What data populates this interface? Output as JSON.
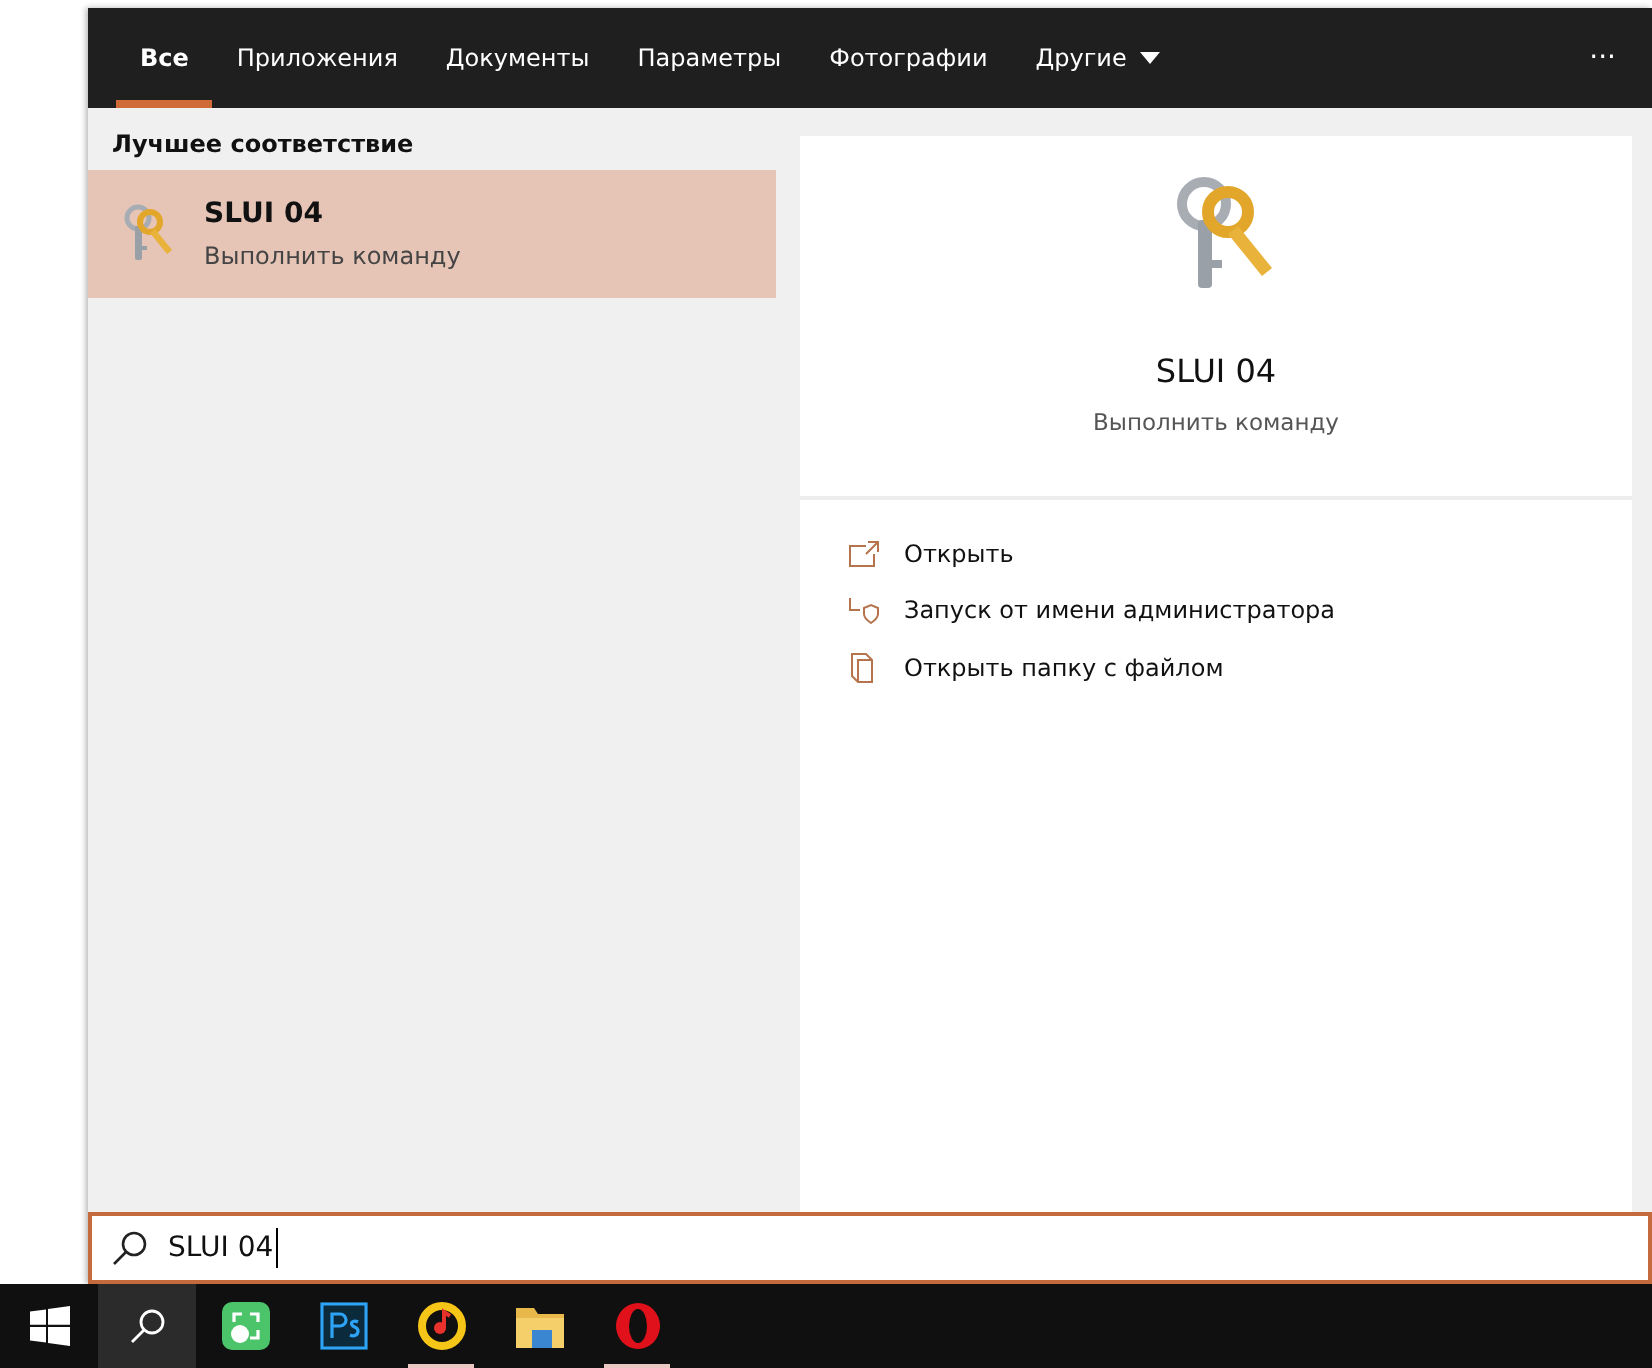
{
  "tabs": [
    {
      "label": "Все",
      "selected": true
    },
    {
      "label": "Приложения",
      "selected": false
    },
    {
      "label": "Документы",
      "selected": false
    },
    {
      "label": "Параметры",
      "selected": false
    },
    {
      "label": "Фотографии",
      "selected": false
    },
    {
      "label": "Другие",
      "selected": false,
      "dropdown": true
    }
  ],
  "more": "···",
  "best_match": {
    "heading": "Лучшее соответствие",
    "title": "SLUI 04",
    "subtitle": "Выполнить команду",
    "selected": true
  },
  "preview": {
    "title": "SLUI 04",
    "subtitle": "Выполнить команду",
    "actions": [
      {
        "kind": "open",
        "label": "Открыть"
      },
      {
        "kind": "admin",
        "label": "Запуск от имени администратора"
      },
      {
        "kind": "folder",
        "label": "Открыть папку с файлом"
      }
    ]
  },
  "search": {
    "value": "SLUI 04"
  },
  "taskbar": [
    {
      "kind": "start",
      "running": false
    },
    {
      "kind": "search",
      "running": false,
      "selected": true
    },
    {
      "kind": "green",
      "running": false
    },
    {
      "kind": "ps",
      "running": false
    },
    {
      "kind": "music",
      "running": true
    },
    {
      "kind": "folder",
      "running": false
    },
    {
      "kind": "opera",
      "running": true
    }
  ]
}
